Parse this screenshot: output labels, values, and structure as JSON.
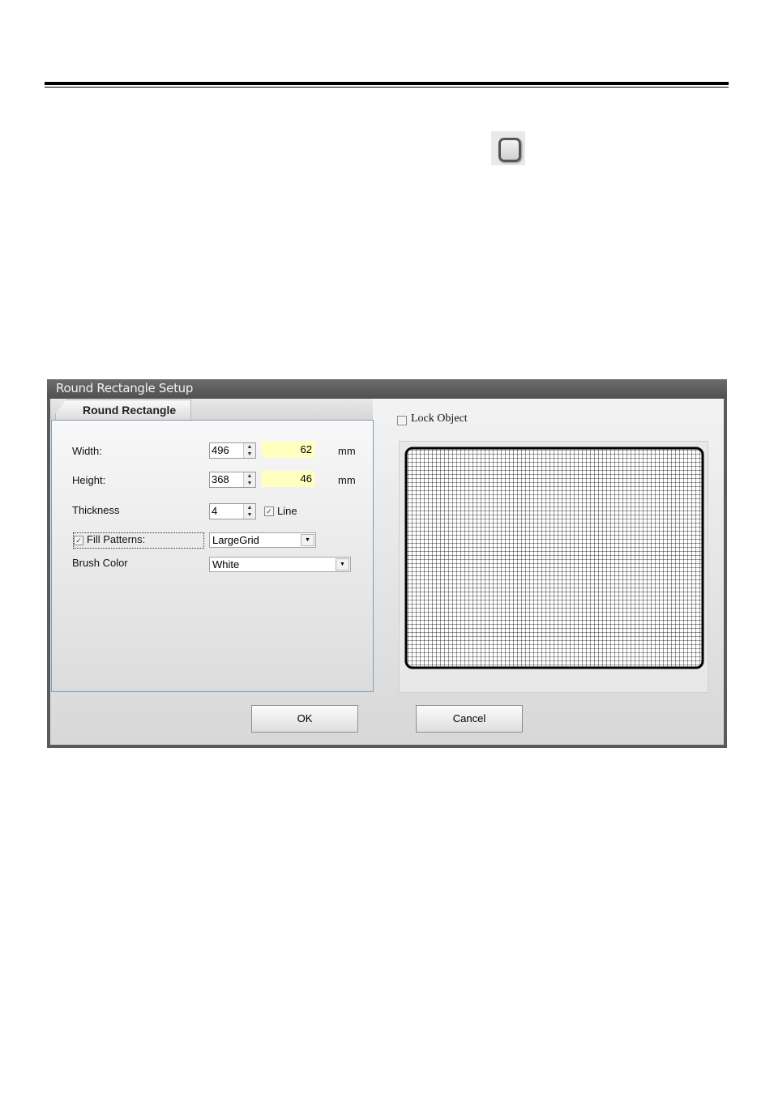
{
  "dialog": {
    "title": "Round Rectangle Setup",
    "tab_label": "Round Rectangle",
    "width": {
      "label": "Width:",
      "dots": "496",
      "mm": "62",
      "unit": "mm"
    },
    "height": {
      "label": "Height:",
      "dots": "368",
      "mm": "46",
      "unit": "mm"
    },
    "thickness": {
      "label": "Thickness",
      "value": "4",
      "line_label": "Line",
      "line_checked": true
    },
    "fill_patterns": {
      "label": "Fill Patterns:",
      "checked": true,
      "value": "LargeGrid"
    },
    "brush_color": {
      "label": "Brush Color",
      "value": "White"
    },
    "lock_object": {
      "label": "Lock Object",
      "checked": false
    },
    "ok_label": "OK",
    "cancel_label": "Cancel"
  },
  "icons": {
    "toolbar": "round-rectangle-tool-icon",
    "spin_up": "▲",
    "spin_down": "▼",
    "dropdown": "▼",
    "check": "✓"
  }
}
